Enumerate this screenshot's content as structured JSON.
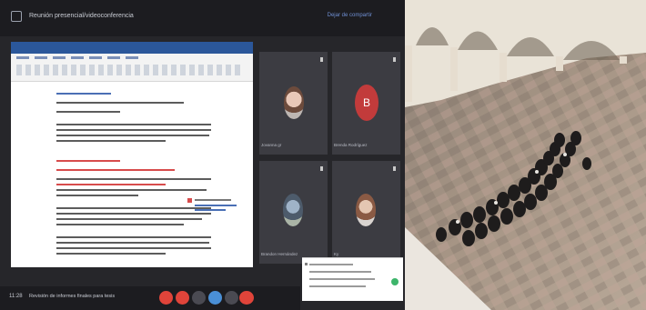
{
  "meeting": {
    "title": "Reunión presencial/videoconferencia",
    "leave_link": "Dejar de compartir",
    "clock": "11:28",
    "subject": "Revisión de informes finales para tesis"
  },
  "participants": [
    {
      "name": "Jovanna gr",
      "initial": ""
    },
    {
      "name": "Brenda Rodríguez",
      "initial": "B"
    },
    {
      "name": "Brandon Hernández",
      "initial": ""
    },
    {
      "name": "Ky",
      "initial": ""
    }
  ],
  "icons": {
    "app": "teams-icon",
    "pin": "pin-icon",
    "chat_send": "send-icon",
    "leave_call": "phone-hangup-icon"
  },
  "colors": {
    "word_blue": "#2b579a",
    "leave_red": "#e0443a",
    "link_blue": "#6f8fd2",
    "avatar_red": "#c23b3b"
  }
}
